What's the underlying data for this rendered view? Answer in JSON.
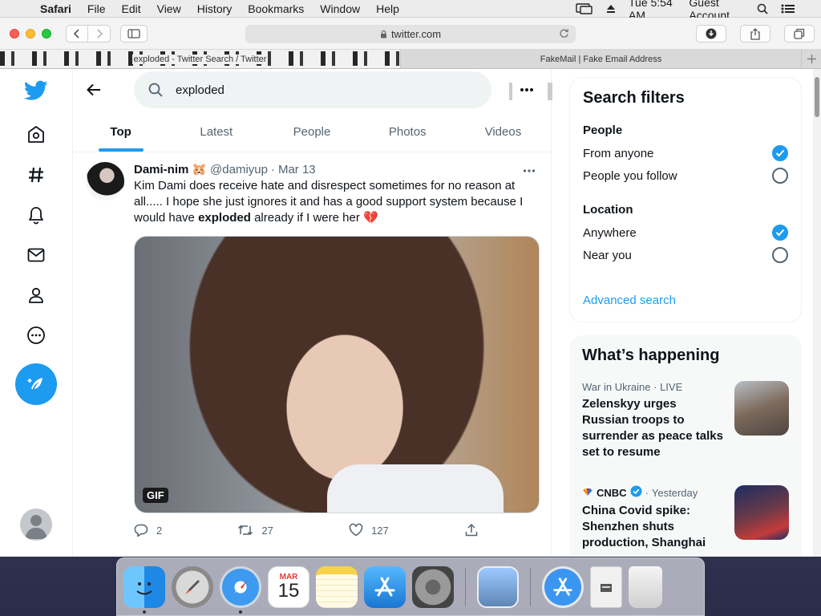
{
  "menubar": {
    "app": "Safari",
    "items": [
      "File",
      "Edit",
      "View",
      "History",
      "Bookmarks",
      "Window",
      "Help"
    ],
    "clock": "Tue 5:54 AM",
    "user": "Guest Account"
  },
  "browser": {
    "url": "twitter.com",
    "tabs": [
      {
        "title": "exploded - Twitter Search / Twitter",
        "active": true
      },
      {
        "title": "FakeMail | Fake Email Address",
        "active": false
      }
    ]
  },
  "search": {
    "query": "exploded"
  },
  "tabs": [
    "Top",
    "Latest",
    "People",
    "Photos",
    "Videos"
  ],
  "tweet": {
    "name": "Dami-nim",
    "emoji": "🐹",
    "handle": "@damiyup",
    "date": "Mar 13",
    "text_before": "Kim Dami does receive hate and disrespect sometimes for no reason at all..... I hope she just ignores it and has a good support system because I would have ",
    "text_bold": "exploded",
    "text_after": " already if I were her 💔",
    "media_badge": "GIF",
    "replies": "2",
    "retweets": "27",
    "likes": "127"
  },
  "search_filters": {
    "title": "Search filters",
    "people_heading": "People",
    "people_options": [
      {
        "label": "From anyone",
        "checked": true
      },
      {
        "label": "People you follow",
        "checked": false
      }
    ],
    "location_heading": "Location",
    "location_options": [
      {
        "label": "Anywhere",
        "checked": true
      },
      {
        "label": "Near you",
        "checked": false
      }
    ],
    "advanced": "Advanced search"
  },
  "happening": {
    "title": "What’s happening",
    "trends": [
      {
        "context_topic": "War in Ukraine",
        "context_live": "LIVE",
        "title": "Zelenskyy urges Russian troops to surrender as peace talks set to resume"
      },
      {
        "source": "CNBC",
        "time": "Yesterday",
        "title": "China Covid spike: Shenzhen shuts production, Shanghai"
      }
    ]
  },
  "dock": [
    "Finder",
    "Launchpad",
    "Safari",
    "Calendar",
    "Notes",
    "App Store",
    "System Preferences",
    "Preview",
    "App Store Downloads",
    "Document",
    "Trash"
  ],
  "calendar_icon": {
    "month": "MAR",
    "day": "15"
  },
  "colors": {
    "accent": "#1d9bf0",
    "text": "#0f1419",
    "muted": "#536471"
  }
}
